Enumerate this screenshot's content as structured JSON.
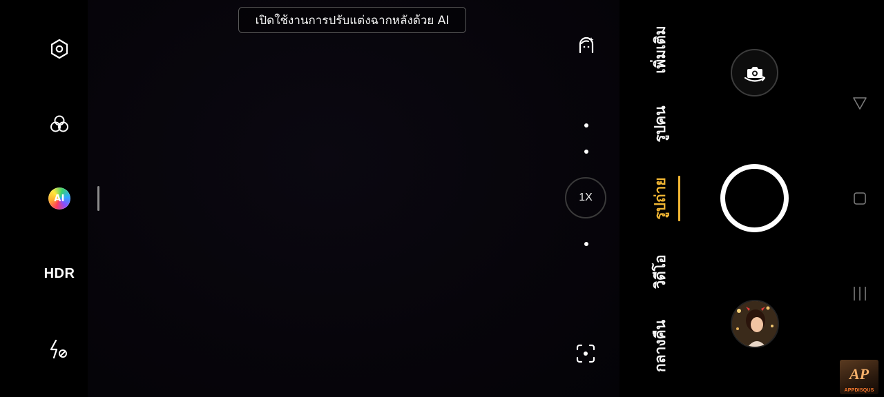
{
  "left_rail": {
    "settings": {
      "icon": "hexagon-settings-icon"
    },
    "filters": {
      "icon": "three-circles-filter-icon"
    },
    "ai": {
      "label": "AI",
      "icon": "ai-scene-icon"
    },
    "hdr": {
      "label": "HDR"
    },
    "flash": {
      "icon": "flash-off-icon"
    }
  },
  "banner": {
    "text": "เปิดใช้งานการปรับแต่งฉากหลังด้วย AI"
  },
  "viewfinder_controls": {
    "beauty": {
      "icon": "face-retouch-icon"
    },
    "zoom_label": "1X",
    "focus": {
      "icon": "focus-frame-icon"
    }
  },
  "modes": {
    "items": [
      {
        "label": "เพิ่มเติม",
        "active": false
      },
      {
        "label": "รูปคน",
        "active": false
      },
      {
        "label": "รูปถ่าย",
        "active": true
      },
      {
        "label": "วิดีโอ",
        "active": false
      },
      {
        "label": "กลางคืน",
        "active": false
      }
    ],
    "active_color": "#f0b533"
  },
  "controls": {
    "flip_camera": {
      "icon": "camera-flip-icon"
    },
    "shutter": {
      "icon": "shutter-button"
    },
    "gallery": {
      "icon": "gallery-thumbnail"
    }
  },
  "nav_bar": {
    "back": {
      "icon": "back-triangle-icon"
    },
    "home": {
      "icon": "home-square-icon"
    },
    "recents": {
      "icon": "recents-lines-icon"
    }
  },
  "watermark": {
    "text": "APPDISQUS"
  }
}
